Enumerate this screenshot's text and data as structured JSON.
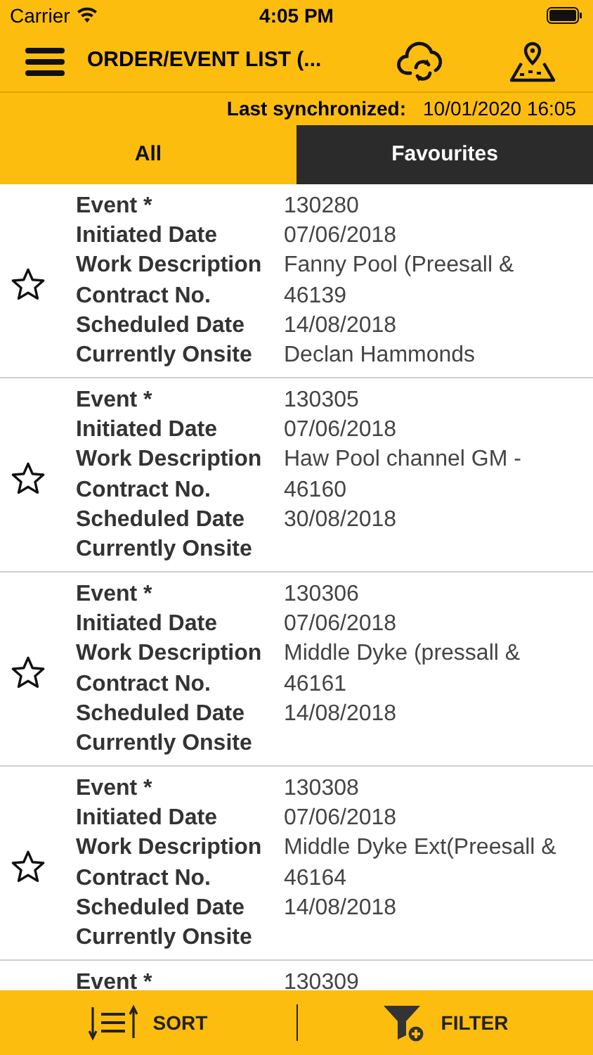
{
  "status_bar": {
    "carrier": "Carrier",
    "time": "4:05 PM"
  },
  "header": {
    "title": "ORDER/EVENT LIST (..."
  },
  "sync": {
    "label": "Last synchronized:",
    "value": "10/01/2020 16:05"
  },
  "tabs": [
    {
      "label": "All",
      "selected": true
    },
    {
      "label": "Favourites",
      "selected": false
    }
  ],
  "events": [
    {
      "favourite": false,
      "fields": [
        {
          "label": "Event *",
          "value": "130280"
        },
        {
          "label": "Initiated Date",
          "value": "07/06/2018"
        },
        {
          "label": "Work Description",
          "value": "Fanny Pool (Preesall &"
        },
        {
          "label": "Contract No.",
          "value": "46139"
        },
        {
          "label": "Scheduled Date",
          "value": "14/08/2018"
        },
        {
          "label": "Currently Onsite",
          "value": "Declan Hammonds"
        }
      ]
    },
    {
      "favourite": false,
      "fields": [
        {
          "label": "Event *",
          "value": "130305"
        },
        {
          "label": "Initiated Date",
          "value": "07/06/2018"
        },
        {
          "label": "Work Description",
          "value": "Haw Pool channel GM -"
        },
        {
          "label": "Contract No.",
          "value": "46160"
        },
        {
          "label": "Scheduled Date",
          "value": "30/08/2018"
        },
        {
          "label": "Currently Onsite"
        }
      ]
    },
    {
      "favourite": false,
      "fields": [
        {
          "label": "Event *",
          "value": "130306"
        },
        {
          "label": "Initiated Date",
          "value": "07/06/2018"
        },
        {
          "label": "Work Description",
          "value": "Middle Dyke (pressall &"
        },
        {
          "label": "Contract No.",
          "value": "46161"
        },
        {
          "label": "Scheduled Date",
          "value": "14/08/2018"
        },
        {
          "label": "Currently Onsite"
        }
      ]
    },
    {
      "favourite": false,
      "fields": [
        {
          "label": "Event *",
          "value": "130308"
        },
        {
          "label": "Initiated Date",
          "value": "07/06/2018"
        },
        {
          "label": "Work Description",
          "value": "Middle Dyke Ext(Preesall &"
        },
        {
          "label": "Contract No.",
          "value": "46164"
        },
        {
          "label": "Scheduled Date",
          "value": "14/08/2018"
        },
        {
          "label": "Currently Onsite"
        }
      ]
    },
    {
      "fields": [
        {
          "label": "Event *",
          "value": "130309"
        }
      ]
    }
  ],
  "bottom_bar": {
    "sort": "SORT",
    "filter": "FILTER"
  }
}
